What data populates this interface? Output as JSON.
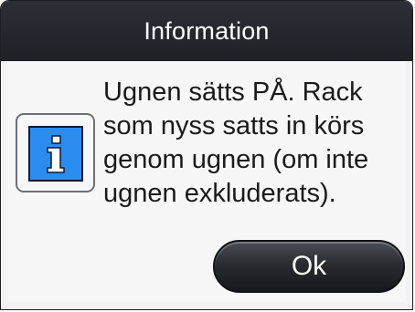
{
  "dialog": {
    "title": "Information",
    "icon": "info-icon",
    "message": "Ugnen sätts PÅ. Rack\nsom nyss satts in körs\ngenom ugnen (om inte\nugnen exkluderats).",
    "ok_label": "Ok"
  },
  "colors": {
    "titlebar": "#1f2127",
    "icon_background": "#2b8cf0",
    "button": "#2a2c32"
  }
}
